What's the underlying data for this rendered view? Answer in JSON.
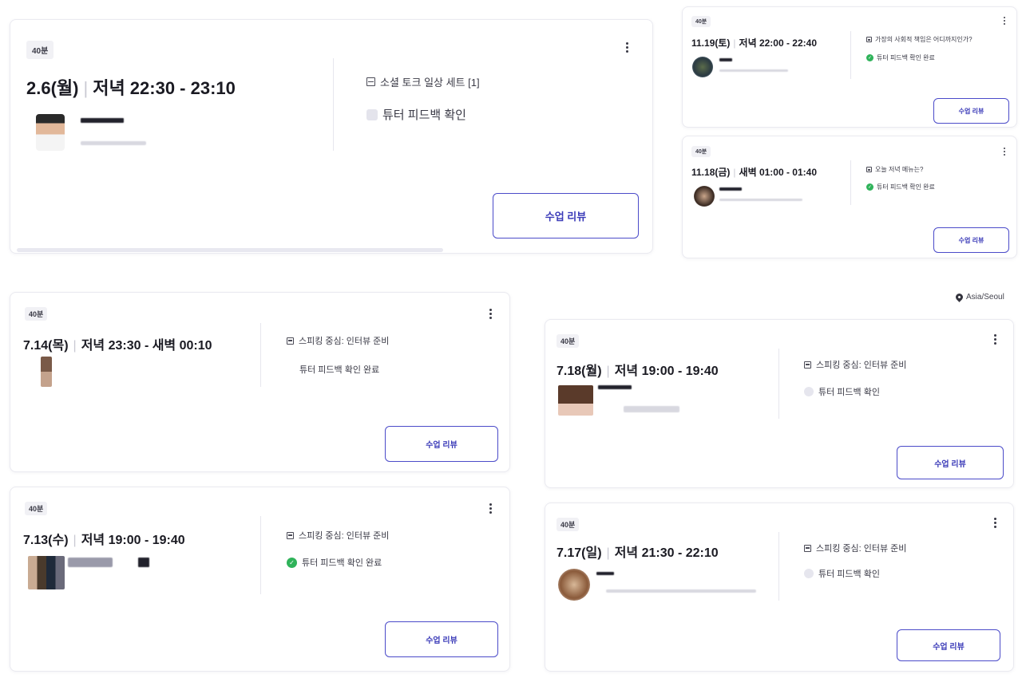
{
  "location": {
    "label": "Asia/Seoul",
    "icon": "map-pin-icon"
  },
  "cards": [
    {
      "badge": "40분",
      "date": "2.6(월)",
      "time": "저녁 22:30 - 23:10",
      "topic": "소셜 토크 일상 세트 [1]",
      "status": "튜터 피드백 확인",
      "status_icon": "thumbs-up-icon",
      "button": "수업 리뷰"
    },
    {
      "badge": "40분",
      "date": "11.19(토)",
      "time": "저녁 22:00 - 22:40",
      "topic": "가장의 사회적 책임은 어디까지인가?",
      "status": "튜터 피드백 확인 완료",
      "status_icon": "check-circle-icon",
      "button": "수업 리뷰"
    },
    {
      "badge": "40분",
      "date": "11.18(금)",
      "time": "새벽 01:00 - 01:40",
      "topic": "오늘 저녁 메뉴는?",
      "status": "튜터 피드백 확인 완료",
      "status_icon": "check-circle-icon",
      "button": "수업 리뷰"
    },
    {
      "badge": "40분",
      "date": "7.14(목)",
      "time": "저녁 23:30 - 새벽 00:10",
      "topic": "스피킹 중심: 인터뷰 준비",
      "status": "튜터 피드백 확인 완료",
      "status_icon": "none",
      "button": "수업 리뷰"
    },
    {
      "badge": "40분",
      "date": "7.13(수)",
      "time": "저녁 19:00 - 19:40",
      "topic": "스피킹 중심: 인터뷰 준비",
      "status": "튜터 피드백 확인 완료",
      "status_icon": "check-circle-icon",
      "button": "수업 리뷰"
    },
    {
      "badge": "40분",
      "date": "7.18(월)",
      "time": "저녁 19:00 - 19:40",
      "topic": "스피킹 중심: 인터뷰 준비",
      "status": "튜터 피드백 확인",
      "status_icon": "empty-circle-icon",
      "button": "수업 리뷰"
    },
    {
      "badge": "40분",
      "date": "7.17(일)",
      "time": "저녁 21:30 - 22:10",
      "topic": "스피킹 중심: 인터뷰 준비",
      "status": "튜터 피드백 확인",
      "status_icon": "empty-circle-icon",
      "button": "수업 리뷰"
    }
  ],
  "colors": {
    "accent": "#4b4bc9",
    "success": "#2fb35a",
    "text": "#1a1a22"
  }
}
